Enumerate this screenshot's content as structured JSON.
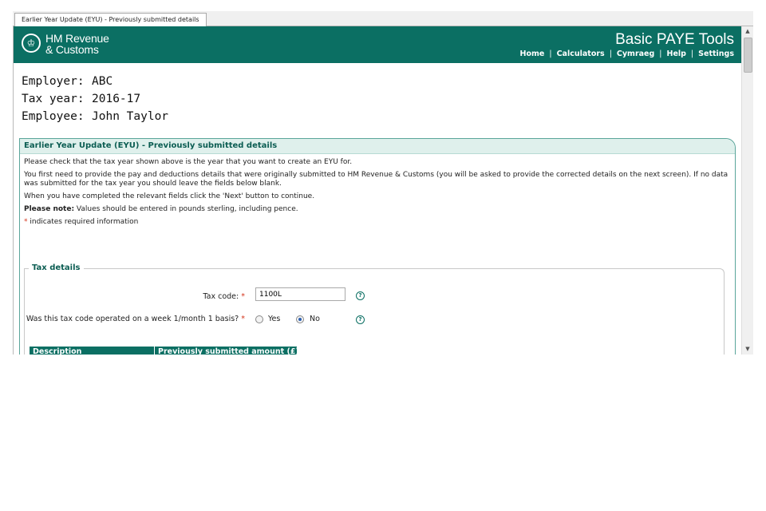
{
  "tab": {
    "title": "Earlier Year Update (EYU) - Previously submitted details"
  },
  "header": {
    "logo_line1": "HM Revenue",
    "logo_line2": "& Customs",
    "app_title": "Basic PAYE Tools",
    "nav": [
      "Home",
      "Calculators",
      "Cymraeg",
      "Help",
      "Settings"
    ]
  },
  "info": {
    "employer_label": "Employer:",
    "employer_value": "ABC",
    "taxyear_label": "Tax year:",
    "taxyear_value": "2016-17",
    "employee_label": "Employee:",
    "employee_value": "John Taylor"
  },
  "panel": {
    "title": "Earlier Year Update (EYU) - Previously submitted details",
    "p1": "Please check that the tax year shown above is the year that you want to create an EYU for.",
    "p2": "You first need to provide the pay and deductions details that were originally submitted to HM Revenue & Customs (you will be asked to provide the corrected details on the next screen). If no data was submitted for the tax year you should leave the fields below blank.",
    "p3": "When you have completed the relevant fields click the 'Next' button to continue.",
    "note_bold": "Please note:",
    "note_text": " Values should be entered in pounds sterling, including pence.",
    "req_star": "*",
    "req_text": " indicates required information"
  },
  "tax_details": {
    "legend": "Tax details",
    "tax_code_label": "Tax code:",
    "tax_code_value": "1100L",
    "week1_label": "Was this tax code operated on a week 1/month 1 basis?",
    "yes_label": "Yes",
    "no_label": "No",
    "selected": "No",
    "help_glyph": "?",
    "required_marker": "*"
  },
  "table": {
    "headers": [
      "Description",
      "Previously submitted amount (£)"
    ]
  },
  "scrollbar": {
    "up": "▲",
    "down": "▼"
  },
  "colors": {
    "brand": "#0b6f63",
    "required": "#d4351c"
  }
}
